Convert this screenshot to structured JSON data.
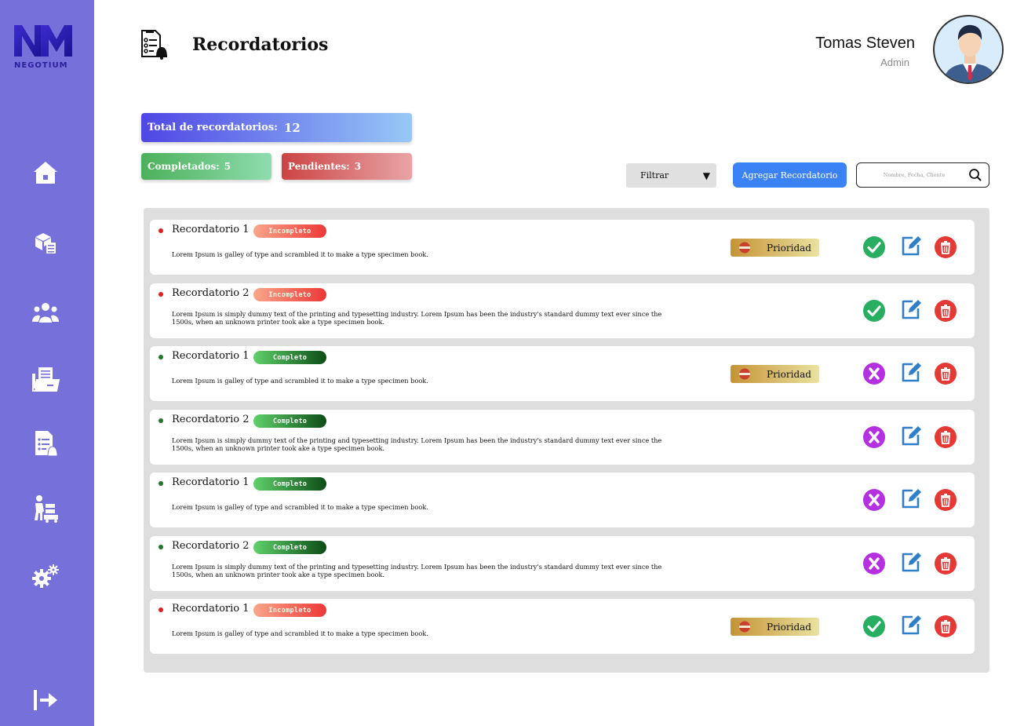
{
  "app": {
    "logo_text": "NEGOTIUM",
    "logo_mark": "NM"
  },
  "sidebar": {
    "items": [
      {
        "icon": "home-icon"
      },
      {
        "icon": "inventory-icon"
      },
      {
        "icon": "users-icon"
      },
      {
        "icon": "folder-icon"
      },
      {
        "icon": "reminders-icon"
      },
      {
        "icon": "delivery-icon"
      },
      {
        "icon": "settings-icon"
      }
    ],
    "logout_icon": "logout-icon"
  },
  "header": {
    "title": "Recordatorios",
    "user_name": "Tomas Steven",
    "user_role": "Admin"
  },
  "stats": {
    "total_label": "Total de recordatorios:",
    "total_value": "12",
    "done_label": "Completados:",
    "done_value": "5",
    "pending_label": "Pendientes:",
    "pending_value": "3"
  },
  "toolbar": {
    "filter_label": "Filtrar",
    "add_label": "Agregar Recordatorio",
    "search_placeholder": "Nombre, Fecha, Cliente"
  },
  "colors": {
    "sidebar": "#7671da",
    "accent": "#3b82f6",
    "incomplete": "#ee3838",
    "complete": "#1c7a28",
    "check": "#27ae60",
    "cancel": "#b530e0",
    "delete": "#e53935",
    "edit": "#2f7fc8"
  },
  "reminders": [
    {
      "title": "Recordatorio 1",
      "status": "Incompleto",
      "state": "incompleto",
      "desc": "Lorem Ipsum is  galley of type and scrambled it to make a type specimen book.",
      "priority": "Prioridad",
      "action_icon": "check-icon"
    },
    {
      "title": "Recordatorio 2",
      "status": "Incompleto",
      "state": "incompleto",
      "desc": "Lorem Ipsum is simply dummy text of the printing and typesetting industry. Lorem Ipsum has been the industry's standard dummy text ever since the 1500s, when an unknown printer took ake a type specimen book.",
      "priority": "",
      "action_icon": "check-icon"
    },
    {
      "title": "Recordatorio 1",
      "status": "Completo",
      "state": "completo",
      "desc": "Lorem Ipsum is  galley of type and scrambled it to make a type specimen book.",
      "priority": "Prioridad",
      "action_icon": "x-icon"
    },
    {
      "title": "Recordatorio 2",
      "status": "Completo",
      "state": "completo",
      "desc": "Lorem Ipsum is simply dummy text of the printing and typesetting industry. Lorem Ipsum has been the industry's standard dummy text ever since the 1500s, when an unknown printer took ake a type specimen book.",
      "priority": "",
      "action_icon": "x-icon"
    },
    {
      "title": "Recordatorio 1",
      "status": "Completo",
      "state": "completo",
      "desc": "Lorem Ipsum is  galley of type and scrambled it to make a type specimen book.",
      "priority": "",
      "action_icon": "x-icon"
    },
    {
      "title": "Recordatorio 2",
      "status": "Completo",
      "state": "completo",
      "desc": "Lorem Ipsum is simply dummy text of the printing and typesetting industry. Lorem Ipsum has been the industry's standard dummy text ever since the 1500s, when an unknown printer took ake a type specimen book.",
      "priority": "",
      "action_icon": "x-icon"
    },
    {
      "title": "Recordatorio 1",
      "status": "Incompleto",
      "state": "incompleto",
      "desc": "Lorem Ipsum is  galley of type and scrambled it to make a type specimen book.",
      "priority": "Prioridad",
      "action_icon": "check-icon"
    }
  ]
}
